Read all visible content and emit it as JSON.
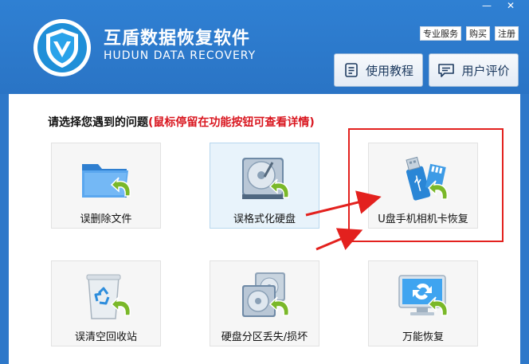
{
  "app": {
    "title": "互盾数据恢复软件",
    "subtitle": "HUDUN DATA RECOVERY"
  },
  "window_controls": {
    "minimize": "—",
    "close": "✕"
  },
  "top_links": [
    "专业服务",
    "购买",
    "注册"
  ],
  "header_buttons": {
    "tutorial": "使用教程",
    "review": "用户评价"
  },
  "prompt": {
    "main": "请选择您遇到的问题",
    "hint": "(鼠标停留在功能按钮可查看详情)"
  },
  "cards": [
    {
      "label": "误删除文件",
      "icon": "folder-restore-icon"
    },
    {
      "label": "误格式化硬盘",
      "icon": "harddisk-restore-icon"
    },
    {
      "label": "U盘手机相机卡恢复",
      "icon": "usb-sdcard-restore-icon"
    },
    {
      "label": "误清空回收站",
      "icon": "recycle-bin-restore-icon"
    },
    {
      "label": "硬盘分区丢失/损坏",
      "icon": "partition-restore-icon"
    },
    {
      "label": "万能恢复",
      "icon": "monitor-restore-icon"
    }
  ],
  "colors": {
    "header_blue": "#2e78c9",
    "annotation_red": "#e3211e",
    "hint_red": "#d9161f",
    "restore_arrow_green": "#7ab829"
  }
}
